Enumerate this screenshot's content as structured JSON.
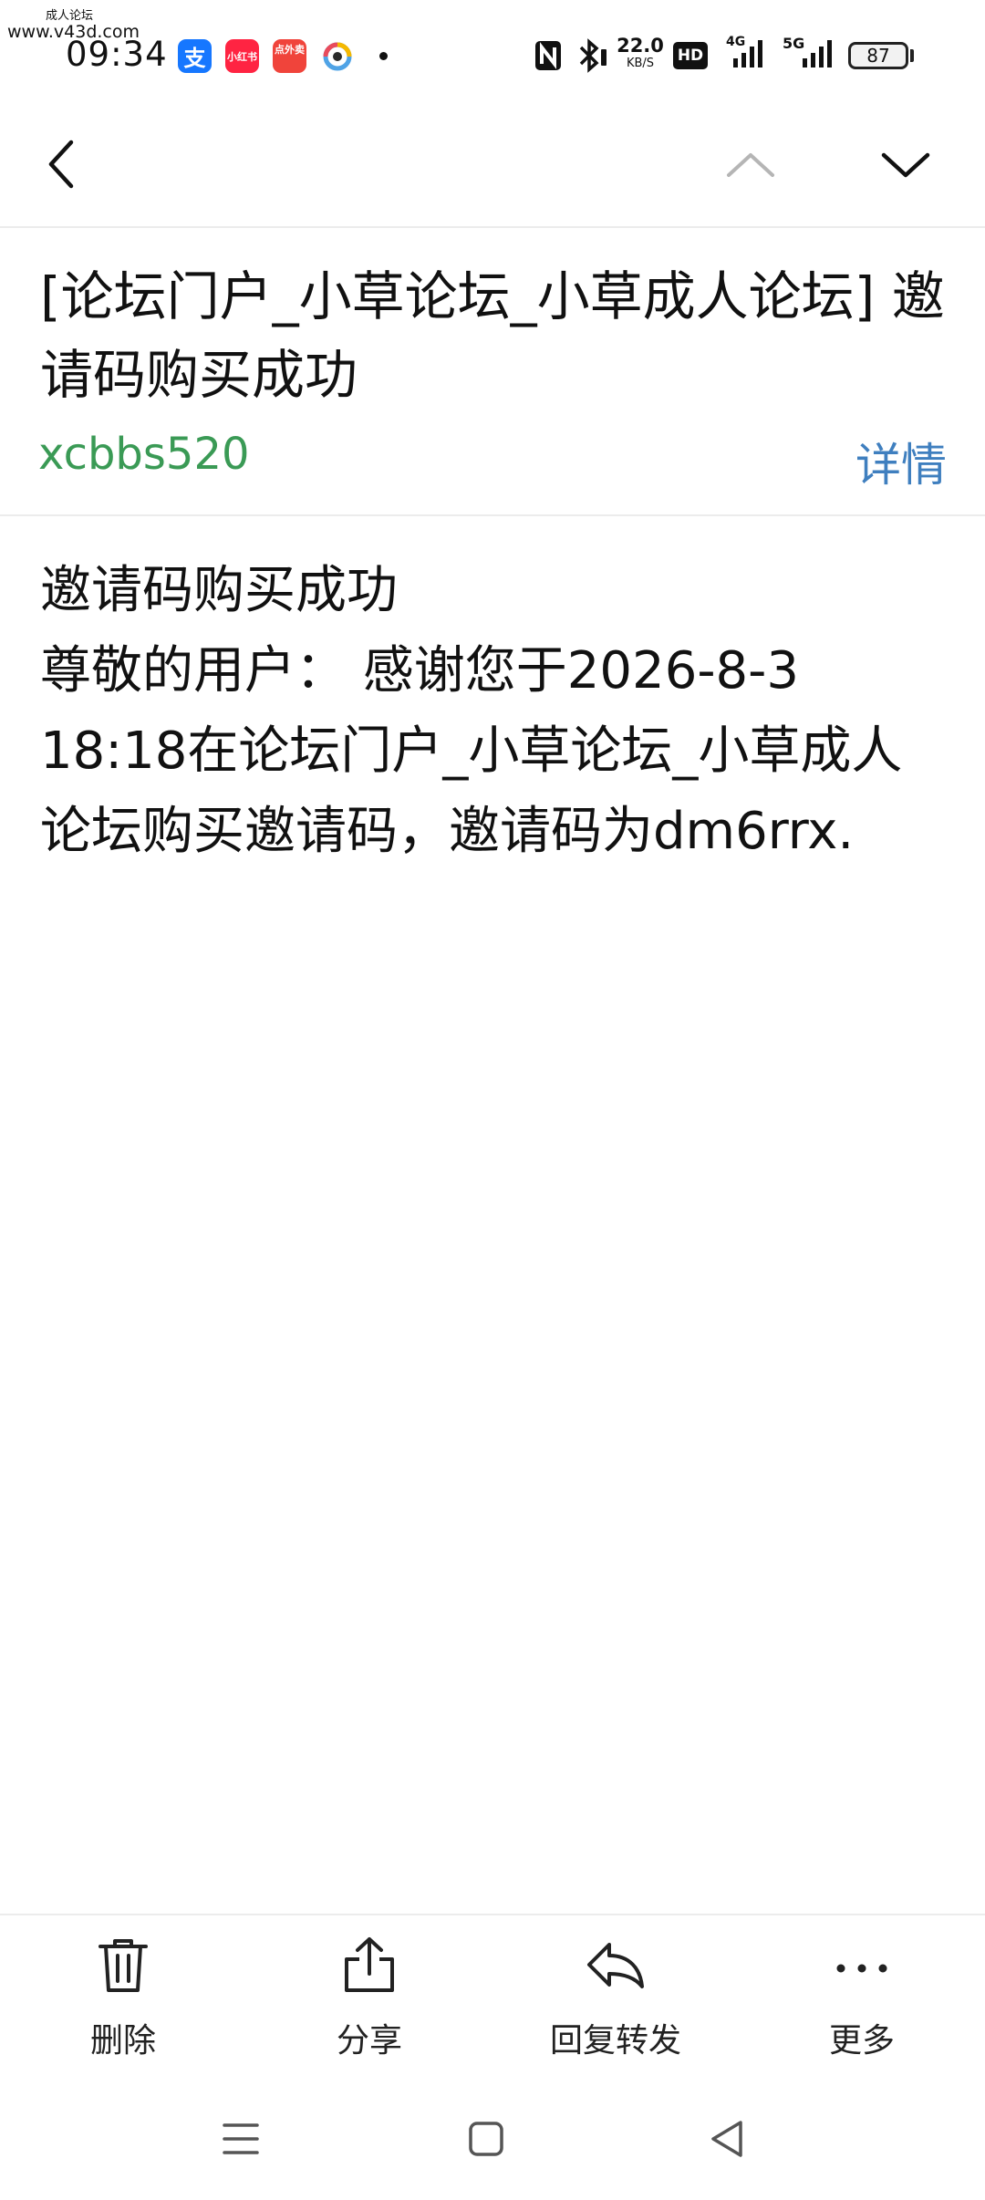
{
  "status_bar": {
    "watermark_top": "成人论坛",
    "watermark_url": "www.v43d.com",
    "time": "09:34",
    "apps": [
      {
        "name": "alipay-icon",
        "label": "支",
        "color": "#1677ff"
      },
      {
        "name": "xiaohongshu-icon",
        "label": "小红书",
        "color": "#ff2442"
      },
      {
        "name": "food-delivery-icon",
        "label": "点外卖",
        "color": "#f0443b"
      },
      {
        "name": "camera-app-icon",
        "label": "",
        "color": "#4fa3e6"
      }
    ],
    "speed_value": "22.0",
    "speed_unit": "KB/S",
    "hd_label": "HD",
    "signal_1": "4G",
    "signal_2": "5G",
    "battery": "87"
  },
  "message": {
    "subject": "[论坛门户_小草论坛_小草成人论坛] 邀请码购买成功",
    "sender": "xcbbs520",
    "details_label": "详情",
    "body_line_1": "邀请码购买成功",
    "body_line_2": "尊敬的用户： 感谢您于2026-8-3 18:18在论坛门户_小草论坛_小草成人论坛购买邀请码，邀请码为dm6rrx."
  },
  "toolbar": {
    "delete_label": "删除",
    "share_label": "分享",
    "reply_forward_label": "回复转发",
    "more_label": "更多"
  },
  "colors": {
    "sender": "#3a9a55",
    "details": "#3f7fbf"
  }
}
